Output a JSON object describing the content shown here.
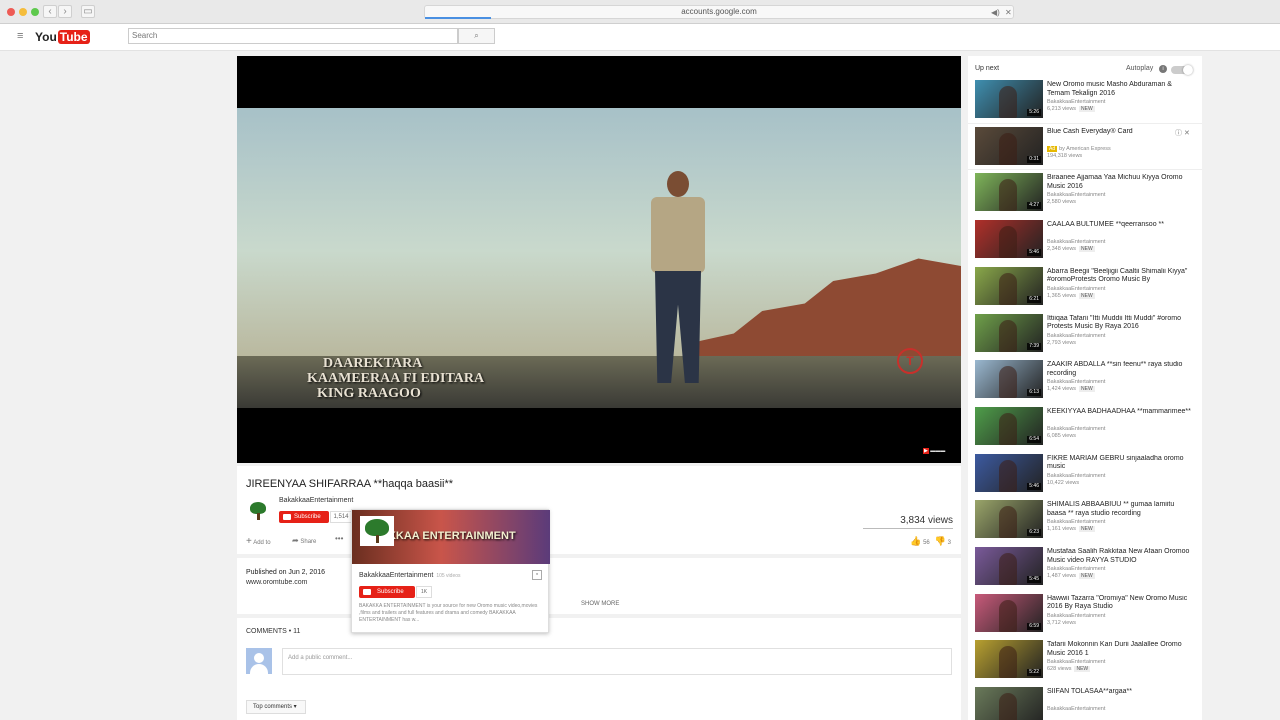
{
  "browser": {
    "url": "accounts.google.com",
    "back_icon": "chevron-left",
    "forward_icon": "chevron-right"
  },
  "masthead": {
    "logo_you": "You",
    "logo_tube": "Tube",
    "search_placeholder": "Search",
    "search_icon": "magnifier"
  },
  "player": {
    "caption_line1": "DAAREKTARA",
    "caption_line2": "KAAMEERAA FI EDITARA",
    "caption_line3": "KING RAAGOO",
    "watermark": "T"
  },
  "video": {
    "title": "JIREENYAA SHIFARRAA **haqqa baasii**",
    "channel": "BakakkaaEntertainment",
    "subscribe_label": "Subscribe",
    "subscriber_count": "1,514",
    "views": "3,834 views",
    "add_to": "Add to",
    "share": "Share",
    "more": "•••",
    "likes": "56",
    "dislikes": "3",
    "published": "Published on Jun 2, 2016",
    "description_url": "www.oromtube.com",
    "show_more": "SHOW MORE"
  },
  "hovercard": {
    "banner_text": "AKKAA ENTERTAINMENT",
    "channel": "BakakkaaEntertainment",
    "video_count": "105 videos",
    "subscribe_label": "Subscribe",
    "subscriber_count": "1K",
    "description": "BAKAKKA ENTERTAINMENT is your source for new Oromo music video,movies ,films and trailers and full features and drama and comedy BAKAKKAA ENTERTAINMENT has w..."
  },
  "comments": {
    "header": "COMMENTS • 11",
    "placeholder": "Add a public comment...",
    "sort_label": "Top comments ▾"
  },
  "sidebar": {
    "up_next": "Up next",
    "autoplay": "Autoplay",
    "items": [
      {
        "title": "New Oromo music Masho Abduraman & Temam Tekalign 2016",
        "channel": "BakakkaaEntertainment",
        "views": "6,213 views",
        "badge": "NEW",
        "duration": "5:26",
        "thumb": "#3f8fb0"
      },
      {
        "title": "Blue Cash Everyday® Card",
        "channel": "by American Express",
        "views": "194,318 views",
        "badge": "",
        "duration": "0:31",
        "thumb": "#5a4a3a",
        "ad": "Ad"
      },
      {
        "title": "Biraanee Ajjamaa Yaa Michuu Kiyya Oromo Music 2016",
        "channel": "BakakkaaEntertainment",
        "views": "2,580 views",
        "badge": "",
        "duration": "4:27",
        "thumb": "#7fb55a"
      },
      {
        "title": "CAALAA BULTUMEE **qeerransoo **",
        "channel": "BakakkaaEntertainment",
        "views": "2,348 views",
        "badge": "NEW",
        "duration": "5:46",
        "thumb": "#b0302a"
      },
      {
        "title": "Abarra Beegii \"Beeljigii Caaltii Shimalii Kiyya\" #oromoProtests Oromo Music By",
        "channel": "BakakkaaEntertainment",
        "views": "1,365 views",
        "badge": "NEW",
        "duration": "6:21",
        "thumb": "#8aa84a"
      },
      {
        "title": "Ittiiqaa Tafarii \"Itti Muddii Itti Muddi\" #oromo Protests Music By Raya 2016",
        "channel": "BakakkaaEntertainment",
        "views": "2,793 views",
        "badge": "",
        "duration": "7:39",
        "thumb": "#6fa04a"
      },
      {
        "title": "ZAAKIR ABDALLA **sin feenu** raya studio recording",
        "channel": "BakakkaaEntertainment",
        "views": "1,424 views",
        "badge": "NEW",
        "duration": "6:13",
        "thumb": "#9ab8d0"
      },
      {
        "title": "KEEKIYYAA BADHAADHAA **mammarimee**",
        "channel": "BakakkaaEntertainment",
        "views": "6,085 views",
        "badge": "",
        "duration": "6:54",
        "thumb": "#4f9e4a"
      },
      {
        "title": "FIKRE MARIAM GEBRU sinjaaladha oromo music",
        "channel": "BakakkaaEntertainment",
        "views": "10,422 views",
        "badge": "",
        "duration": "5:46",
        "thumb": "#3c5aa0"
      },
      {
        "title": "SHIMALIS ABBAABIUU ** gumaa lamiitu baasa ** raya studio recording",
        "channel": "BakakkaaEntertainment",
        "views": "1,161 views",
        "badge": "NEW",
        "duration": "6:23",
        "thumb": "#9aa56a"
      },
      {
        "title": "Mustafaa Saalih Rakkitaa New Afaan Oromoo Music video RAYYA STUDIO",
        "channel": "BakakkaaEntertainment",
        "views": "1,487 views",
        "badge": "NEW",
        "duration": "5:45",
        "thumb": "#7a5a9a"
      },
      {
        "title": "Hawwii Tazarra \"Oromiya\" New Oromo Music 2016 By Raya Studio",
        "channel": "BakakkaaEntertainment",
        "views": "3,712 views",
        "badge": "",
        "duration": "6:59",
        "thumb": "#c85a7a"
      },
      {
        "title": "Tafarii Mokonnin Kan Durii Jaalallee Oromo Music 2016 1",
        "channel": "BakakkaaEntertainment",
        "views": "628 views",
        "badge": "NEW",
        "duration": "5:22",
        "thumb": "#b8a030"
      },
      {
        "title": "SIIFAN TOLASAA**argaa**",
        "channel": "BakakkaaEntertainment",
        "views": "",
        "badge": "",
        "duration": "",
        "thumb": "#6a7a5a"
      }
    ]
  }
}
